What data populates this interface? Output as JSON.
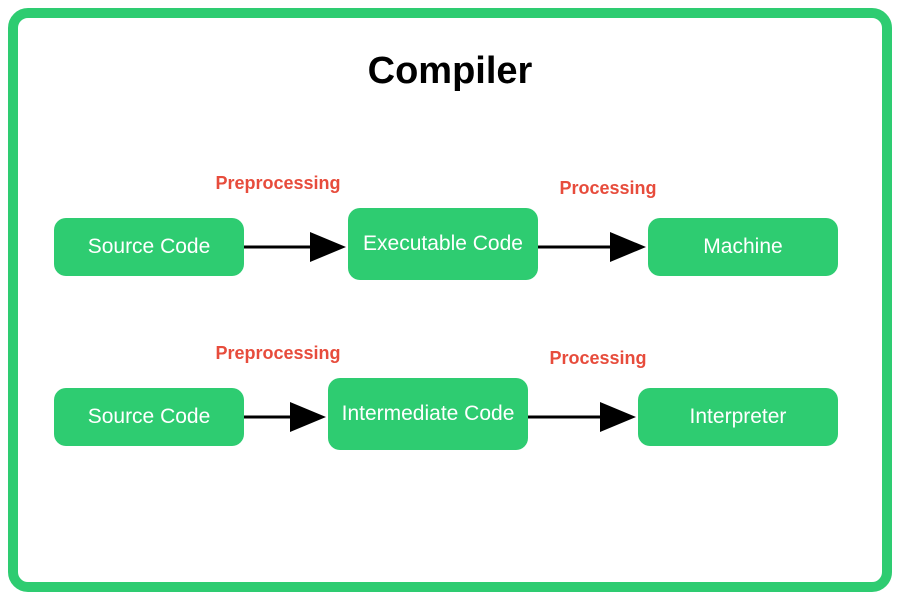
{
  "title": "Compiler",
  "colors": {
    "accent": "#2ecc71",
    "labelRed": "#e74c3c"
  },
  "rows": [
    {
      "nodes": [
        "Source Code",
        "Executable Code",
        "Machine"
      ],
      "edges": [
        "Preprocessing",
        "Processing"
      ]
    },
    {
      "nodes": [
        "Source Code",
        "Intermediate Code",
        "Interpreter"
      ],
      "edges": [
        "Preprocessing",
        "Processing"
      ]
    }
  ]
}
